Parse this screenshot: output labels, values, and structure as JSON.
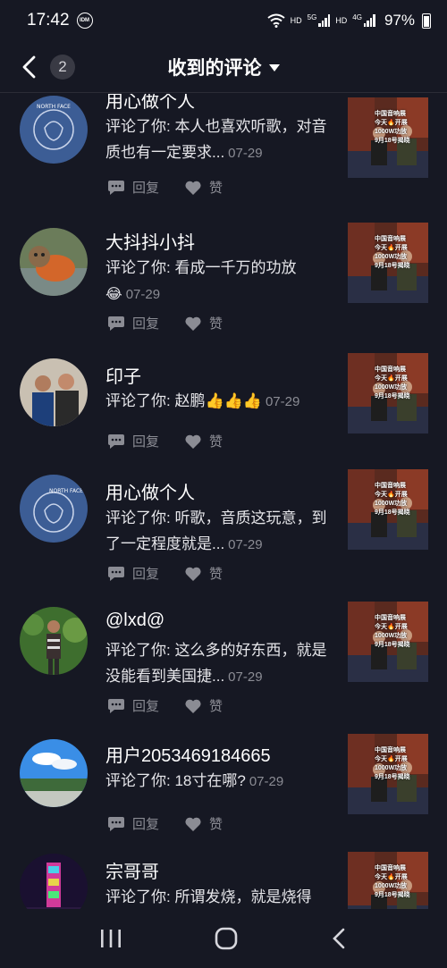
{
  "status": {
    "time": "17:42",
    "idm": "IDM",
    "hd1": "HD",
    "net1": "5G",
    "hd2": "HD",
    "net2": "4G",
    "battery": "97%"
  },
  "header": {
    "badge_count": "2",
    "title": "收到的评论"
  },
  "labels": {
    "reply": "回复",
    "like": "赞"
  },
  "items": [
    {
      "name": "用心做个人",
      "comment": "评论了你: 本人也喜欢听歌，对音质也有一定要求...",
      "date": "07-29"
    },
    {
      "name": "大抖抖小抖",
      "comment": "评论了你: 看成一千万的功放",
      "date": "07-29"
    },
    {
      "name": "印子",
      "comment": "评论了你: 赵鹏👍👍👍",
      "date": "07-29"
    },
    {
      "name": "用心做个人",
      "comment": "评论了你: 听歌，音质这玩意，到了一定程度就是...",
      "date": "07-29"
    },
    {
      "name": "@lxd@",
      "comment": "评论了你: 这么多的好东西，就是没能看到美国捷...",
      "date": "07-29"
    },
    {
      "name": "用户2053469184665",
      "comment": "评论了你: 18寸在哪?",
      "date": "07-29"
    },
    {
      "name": "宗哥哥",
      "comment": "评论了你: 所谓发烧，就是烧得",
      "date": ""
    }
  ],
  "thumb_text": [
    "中国音响展",
    "今天🔥开展",
    "1000W功放",
    "9月18号揭晓"
  ],
  "colors": {
    "background": "#161823",
    "secondary_text": "#8b8c94",
    "divider": "#2b2c36"
  }
}
